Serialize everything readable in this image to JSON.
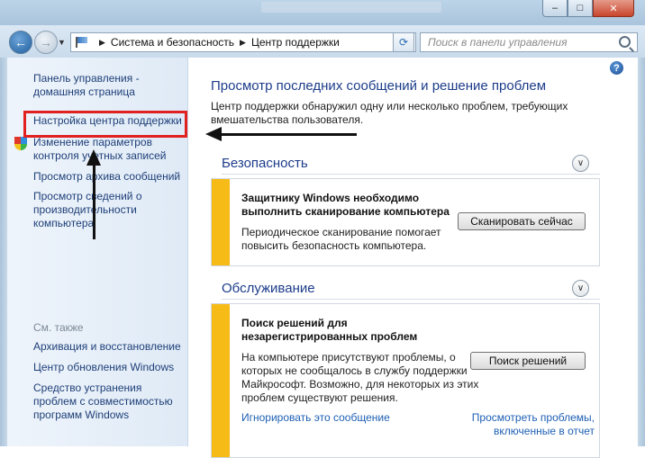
{
  "window": {
    "minimize": "–",
    "maximize": "□",
    "close": "✕"
  },
  "nav": {
    "breadcrumbs": [
      "Система и безопасность",
      "Центр поддержки"
    ],
    "search_placeholder": "Поиск в панели управления"
  },
  "sidebar": {
    "home_link": "Панель управления - домашняя страница",
    "items": [
      "Настройка центра поддержки",
      "Изменение параметров контроля учетных записей",
      "Просмотр архива сообщений",
      "Просмотр сведений о производительности компьютера"
    ],
    "see_also_title": "См. также",
    "see_also": [
      "Архивация и восстановление",
      "Центр обновления Windows",
      "Средство устранения проблем с совместимостью программ Windows"
    ]
  },
  "main": {
    "heading": "Просмотр последних сообщений и решение проблем",
    "intro": "Центр поддержки обнаружил одну или несколько проблем, требующих вмешательства пользователя.",
    "security": {
      "title": "Безопасность",
      "message_title": "Защитнику Windows необходимо выполнить сканирование компьютера",
      "message_desc": "Периодическое сканирование помогает повысить безопасность компьютера.",
      "button": "Сканировать сейчас"
    },
    "maintenance": {
      "title": "Обслуживание",
      "message_title": "Поиск решений для незарегистрированных проблем",
      "message_desc": "На компьютере присутствуют проблемы, о которых не сообщалось в службу поддержки Майкрософт. Возможно, для некоторых из этих проблем существуют решения.",
      "button": "Поиск решений",
      "ignore_link": "Игнорировать это сообщение",
      "view_link": "Просмотреть проблемы, включенные в отчет"
    }
  },
  "colors": {
    "accent_heading": "#1c3c8a",
    "link": "#1e3f78",
    "warning_stripe": "#f7bb17",
    "annotation_box": "#e12020"
  }
}
